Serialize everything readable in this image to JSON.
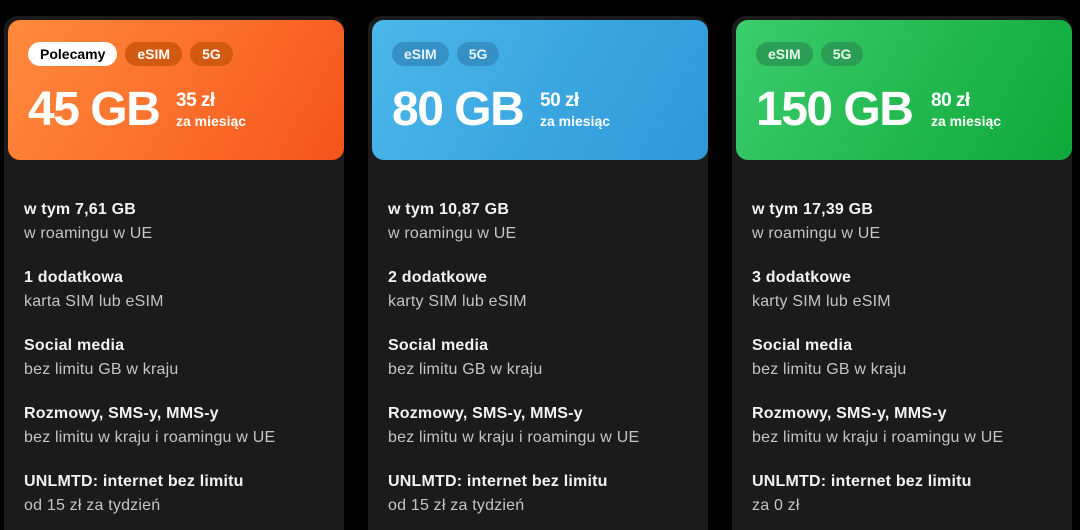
{
  "plans": [
    {
      "badges": {
        "recommended": "Polecamy",
        "esim": "eSIM",
        "network": "5G"
      },
      "data_amount": "45 GB",
      "price": "35 zł",
      "period": "za miesiąc",
      "features": [
        {
          "title": "w tym 7,61 GB",
          "sub": "w roamingu w UE"
        },
        {
          "title": "1 dodatkowa",
          "sub": "karta SIM lub eSIM"
        },
        {
          "title": "Social media",
          "sub": "bez limitu GB w kraju"
        },
        {
          "title": "Rozmowy, SMS-y, MMS-y",
          "sub": "bez limitu w kraju i roamingu w UE"
        },
        {
          "title": "UNLMTD: internet bez limitu",
          "sub": "od 15 zł za tydzień"
        }
      ],
      "accent": "#fb6e2b"
    },
    {
      "badges": {
        "esim": "eSIM",
        "network": "5G"
      },
      "data_amount": "80 GB",
      "price": "50 zł",
      "period": "za miesiąc",
      "features": [
        {
          "title": "w tym 10,87 GB",
          "sub": "w roamingu w UE"
        },
        {
          "title": "2 dodatkowe",
          "sub": "karty SIM lub eSIM"
        },
        {
          "title": "Social media",
          "sub": "bez limitu GB w kraju"
        },
        {
          "title": "Rozmowy, SMS-y, MMS-y",
          "sub": "bez limitu w kraju i roamingu w UE"
        },
        {
          "title": "UNLMTD: internet bez limitu",
          "sub": "od 15 zł za tydzień"
        }
      ],
      "accent": "#3aa6e0"
    },
    {
      "badges": {
        "esim": "eSIM",
        "network": "5G"
      },
      "data_amount": "150 GB",
      "price": "80 zł",
      "period": "za miesiąc",
      "features": [
        {
          "title": "w tym 17,39 GB",
          "sub": "w roamingu w UE"
        },
        {
          "title": "3 dodatkowe",
          "sub": "karty SIM lub eSIM"
        },
        {
          "title": "Social media",
          "sub": "bez limitu GB w kraju"
        },
        {
          "title": "Rozmowy, SMS-y, MMS-y",
          "sub": "bez limitu w kraju i roamingu w UE"
        },
        {
          "title": "UNLMTD: internet bez limitu",
          "sub": "za 0 zł"
        }
      ],
      "accent": "#22b84f"
    }
  ],
  "colors": {
    "background": "#000000",
    "card": "#1b1b1b",
    "text": "#f2f2f2",
    "muted": "#c4c4c4"
  }
}
